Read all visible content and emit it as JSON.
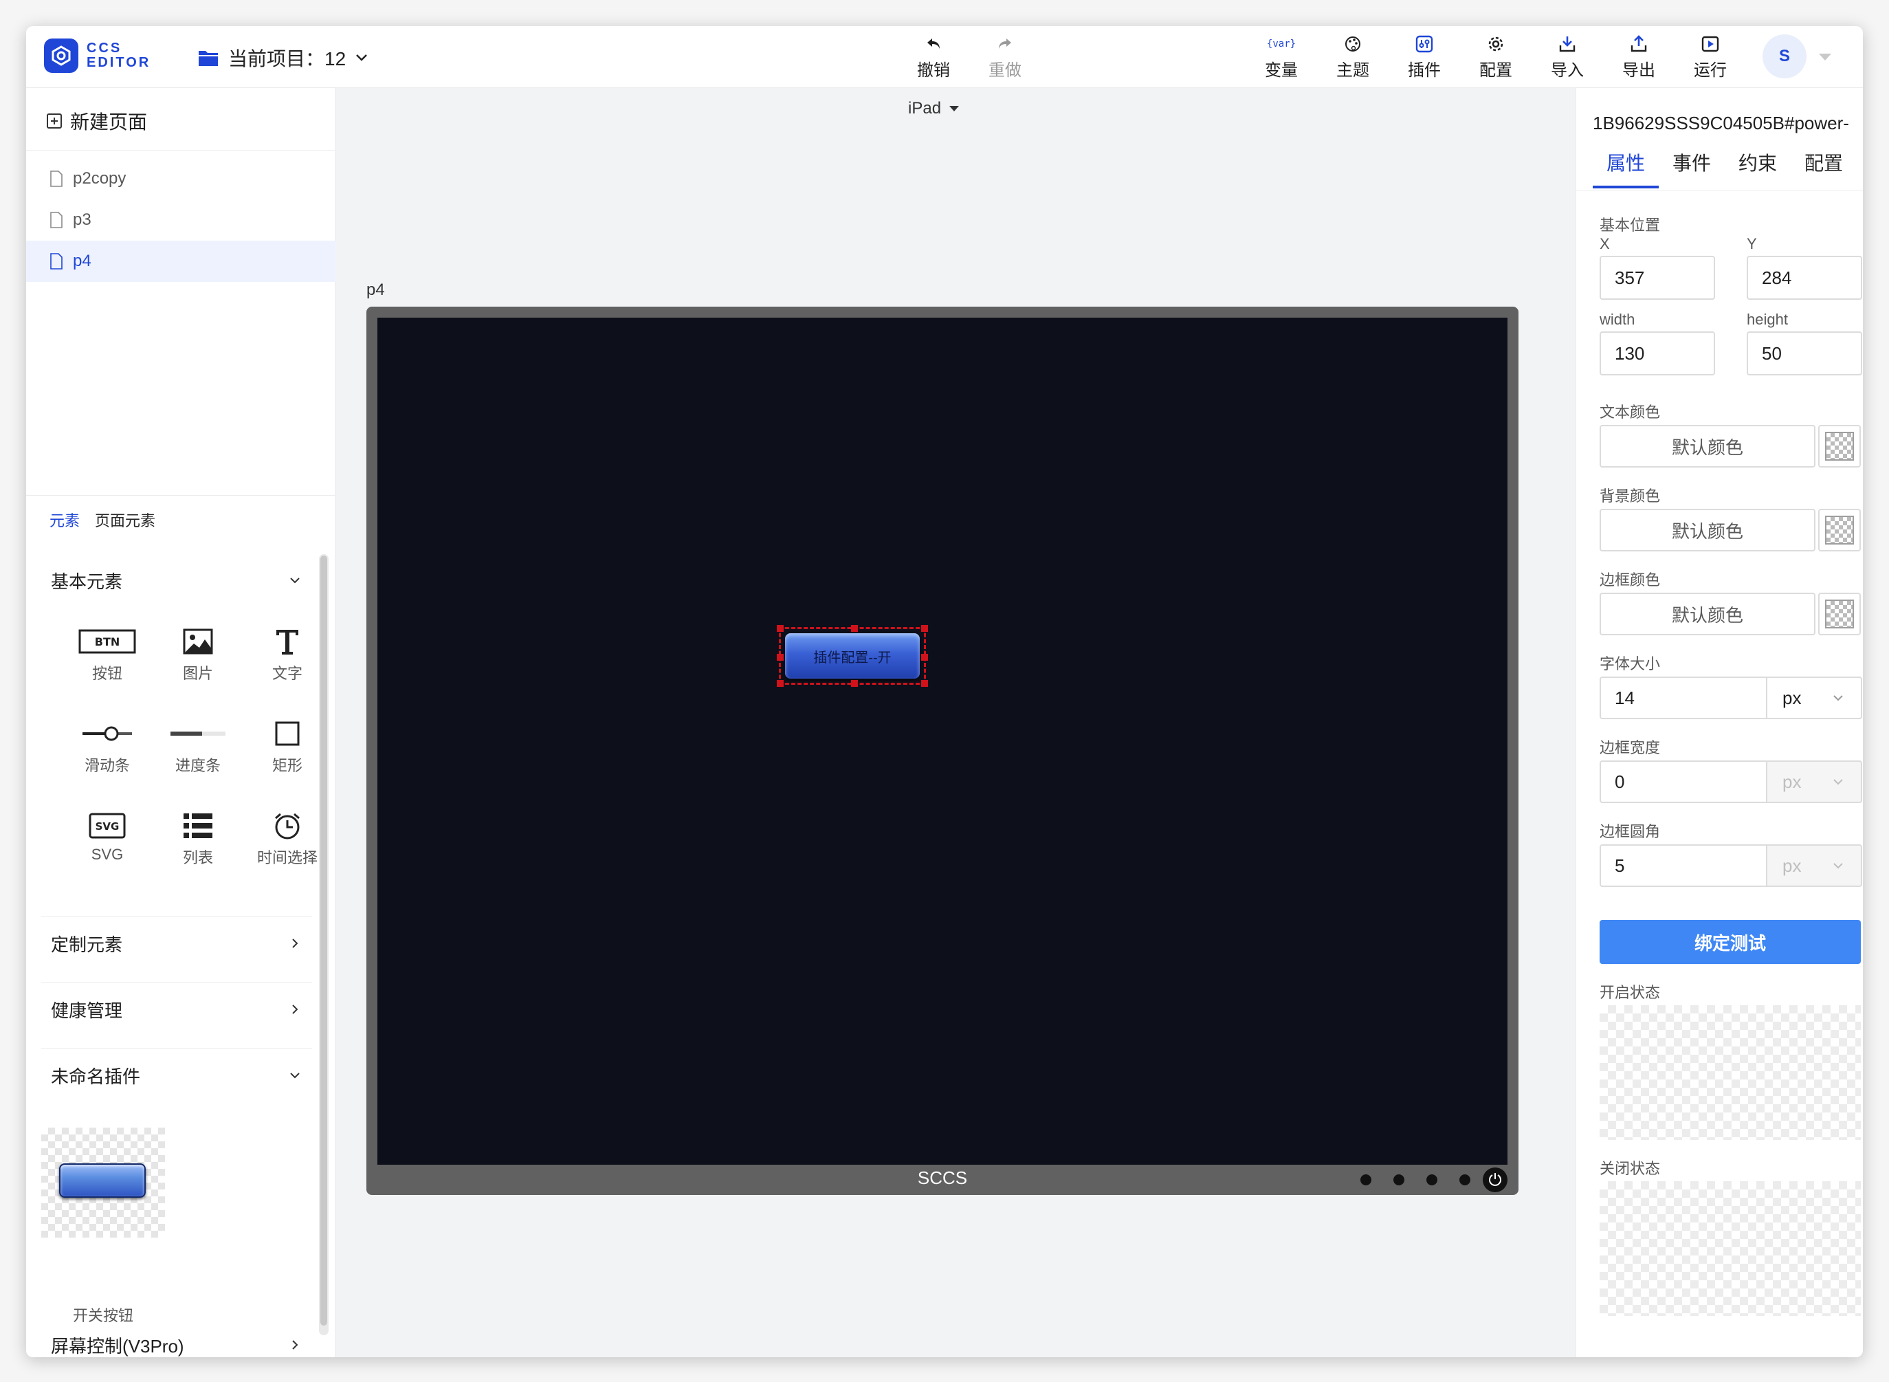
{
  "app": {
    "logo_line1": "CCS",
    "logo_line2": "EDITOR",
    "brand_color": "#1f46d6"
  },
  "header": {
    "project_label": "当前项目：12",
    "undo": "撤销",
    "redo": "重做",
    "toolbar": [
      {
        "label": "变量",
        "icon": "var-icon"
      },
      {
        "label": "主题",
        "icon": "palette-icon"
      },
      {
        "label": "插件",
        "icon": "plugin-icon"
      },
      {
        "label": "配置",
        "icon": "gear-icon"
      },
      {
        "label": "导入",
        "icon": "import-icon"
      },
      {
        "label": "导出",
        "icon": "export-icon"
      },
      {
        "label": "运行",
        "icon": "play-icon"
      }
    ],
    "var_icon_text": "{var}",
    "avatar": "S"
  },
  "left": {
    "new_page": "新建页面",
    "pages": [
      "p2copy",
      "p3",
      "p4"
    ],
    "active_page": "p4",
    "tabs": [
      "元素",
      "页面元素"
    ],
    "sections": {
      "basic": "基本元素",
      "custom": "定制元素",
      "health": "健康管理",
      "unnamed": "未命名插件",
      "screen": "屏幕控制(V3Pro)"
    },
    "elements": [
      {
        "label": "按钮",
        "icon": "button-icon"
      },
      {
        "label": "图片",
        "icon": "image-icon"
      },
      {
        "label": "文字",
        "icon": "text-icon"
      },
      {
        "label": "滑动条",
        "icon": "slider-icon"
      },
      {
        "label": "进度条",
        "icon": "progress-icon"
      },
      {
        "label": "矩形",
        "icon": "rect-icon"
      },
      {
        "label": "SVG",
        "icon": "svg-icon"
      },
      {
        "label": "列表",
        "icon": "list-icon"
      },
      {
        "label": "时间选择",
        "icon": "clock-icon"
      }
    ],
    "btn_icon_text": "BTN",
    "svg_icon_text": "SVG",
    "plugin_name": "开关按钮"
  },
  "canvas": {
    "device": "iPad",
    "page_label": "p4",
    "brand": "SCCS",
    "switch_text": "插件配置--开",
    "screen_color": "#0d0f1b",
    "selection_color": "#d0121b"
  },
  "right": {
    "component_id": "1B96629SSS9C04505B#power-",
    "tabs": [
      "属性",
      "事件",
      "约束",
      "配置"
    ],
    "position_label": "基本位置",
    "x_label": "X",
    "y_label": "Y",
    "x": "357",
    "y": "284",
    "width_label": "width",
    "height_label": "height",
    "width": "130",
    "height": "50",
    "text_color_label": "文本颜色",
    "bg_color_label": "背景颜色",
    "border_color_label": "边框颜色",
    "default_color": "默认颜色",
    "font_size_label": "字体大小",
    "font_size": "14",
    "border_width_label": "边框宽度",
    "border_width": "0",
    "border_radius_label": "边框圆角",
    "border_radius": "5",
    "unit": "px",
    "bind_button": "绑定测试",
    "on_state_label": "开启状态",
    "off_state_label": "关闭状态",
    "primary_color": "#3f87f5"
  }
}
